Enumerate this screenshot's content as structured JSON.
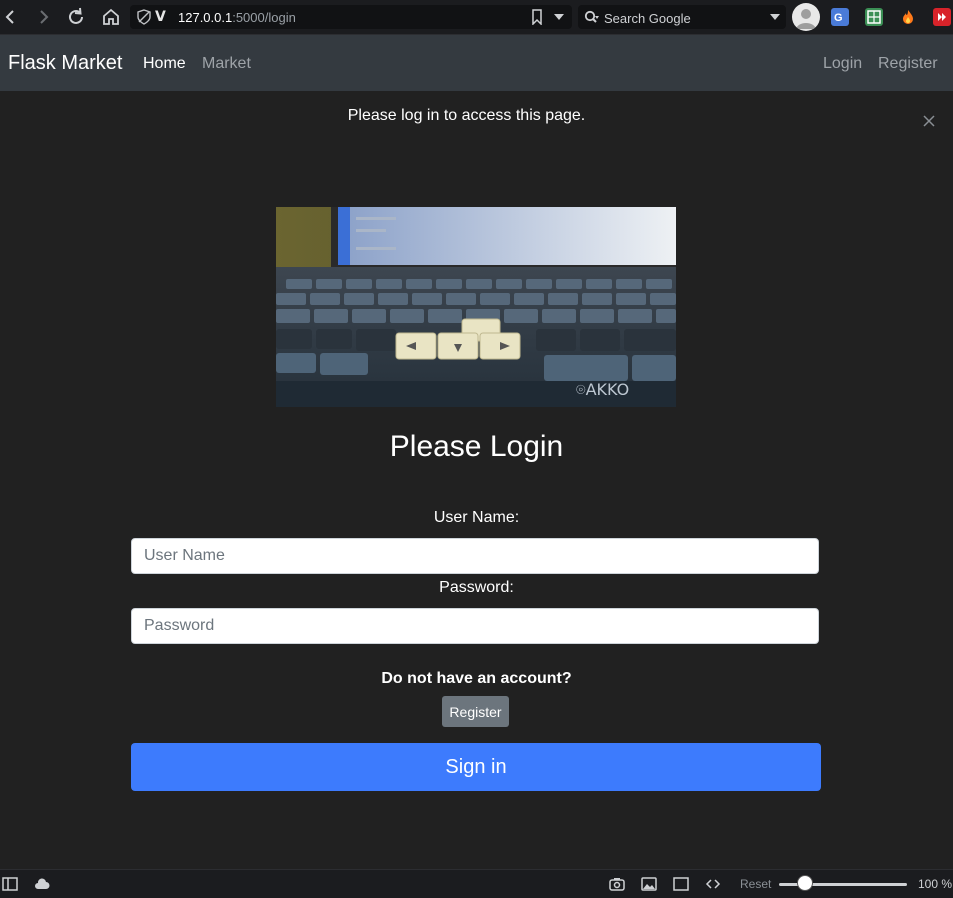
{
  "browser": {
    "url_host": "127.0.0.1",
    "url_path": ":5000/login",
    "search_placeholder": "Search Google"
  },
  "navbar": {
    "brand": "Flask Market",
    "links": [
      {
        "label": "Home"
      },
      {
        "label": "Market"
      }
    ],
    "right_links": [
      {
        "label": "Login"
      },
      {
        "label": "Register"
      }
    ]
  },
  "flash": {
    "message": "Please log in to access this page."
  },
  "login": {
    "title": "Please Login",
    "username_label": "User Name:",
    "username_placeholder": "User Name",
    "password_label": "Password:",
    "password_placeholder": "Password",
    "no_account_text": "Do not have an account?",
    "register_label": "Register",
    "signin_label": "Sign in"
  },
  "statusbar": {
    "reset_label": "Reset",
    "zoom_level": "100 %",
    "zoom_fraction": 0.14
  },
  "colors": {
    "page_bg": "#212121",
    "navbar_bg": "#343a40",
    "primary": "#3d7bfd",
    "secondary": "#6c757d"
  }
}
